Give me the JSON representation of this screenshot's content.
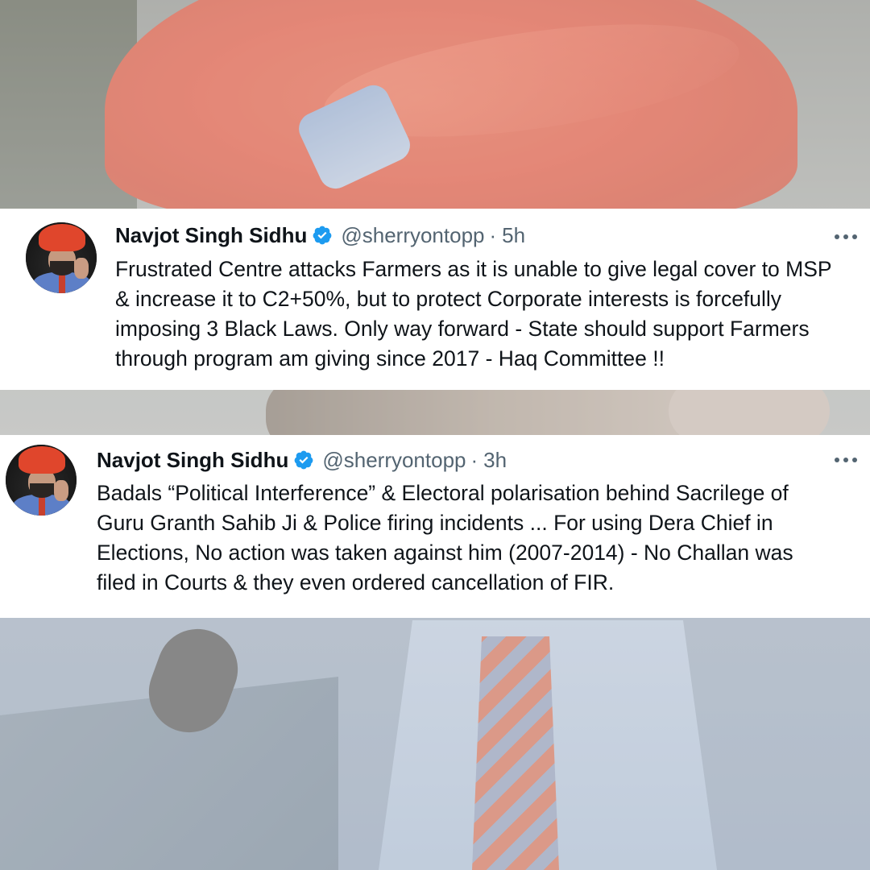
{
  "tweets": [
    {
      "author": {
        "name": "Navjot Singh Sidhu",
        "handle": "@sherryontopp",
        "verified": true,
        "avatar_icon": "profile-photo"
      },
      "separator": "·",
      "time": "5h",
      "text_lines": [
        "Frustrated Centre attacks Farmers as it is unable to give legal cover to MSP",
        "& increase it to C2+50%, but to protect Corporate interests is forcefully",
        "imposing 3 Black Laws. Only way forward - State should support Farmers",
        "through program am giving since 2017 - Haq Committee !!"
      ]
    },
    {
      "author": {
        "name": "Navjot Singh Sidhu",
        "handle": "@sherryontopp",
        "verified": true,
        "avatar_icon": "profile-photo"
      },
      "separator": "·",
      "time": "3h",
      "text_lines": [
        "Badals “Political Interference” & Electoral polarisation behind Sacrilege of",
        "Guru Granth Sahib Ji & Police firing incidents ... For using Dera Chief in",
        "Elections, No action was taken against him (2007-2014) - No Challan was",
        "filed in Courts & they even ordered cancellation of FIR."
      ]
    }
  ],
  "colors": {
    "verified_badge": "#1d9bf0",
    "name_text": "#0f1419",
    "secondary_text": "#536471",
    "card_background": "#ffffff"
  }
}
